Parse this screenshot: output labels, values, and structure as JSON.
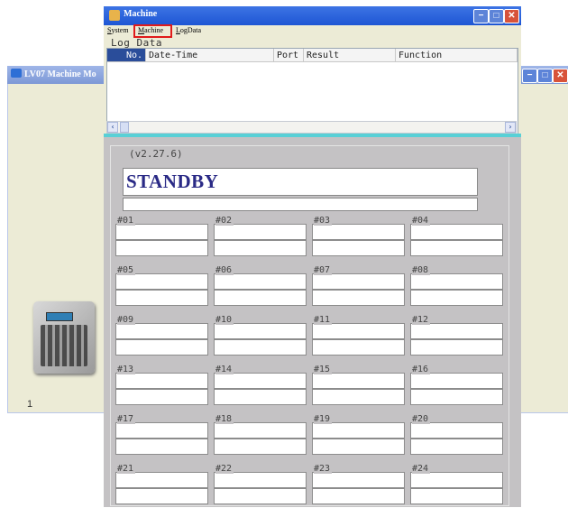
{
  "background_window": {
    "title": "LV07 Machine Mo",
    "number_label": "1"
  },
  "window": {
    "title": "Machine"
  },
  "menu": {
    "items": [
      {
        "label": "System",
        "accel": "S",
        "rest": "ystem"
      },
      {
        "label": "Machine",
        "accel": "M",
        "rest": "achine"
      },
      {
        "label": "LogData",
        "accel": "L",
        "rest": "ogData"
      }
    ],
    "highlighted": "Machine"
  },
  "log": {
    "label": "Log Data",
    "columns": [
      "No.",
      "Date-Time",
      "Port",
      "Result",
      "Function"
    ],
    "rows": []
  },
  "status": {
    "version": "(v2.27.6)",
    "state": "STANDBY"
  },
  "ports": [
    "#01",
    "#02",
    "#03",
    "#04",
    "#05",
    "#06",
    "#07",
    "#08",
    "#09",
    "#10",
    "#11",
    "#12",
    "#13",
    "#14",
    "#15",
    "#16",
    "#17",
    "#18",
    "#19",
    "#20",
    "#21",
    "#22",
    "#23",
    "#24"
  ],
  "colors": {
    "titlebar": "#1e56d4",
    "highlight_box": "#e01b1b",
    "splitter": "#58d0d6",
    "status_text": "#2a2a86",
    "panel": "#c4c2c4"
  }
}
